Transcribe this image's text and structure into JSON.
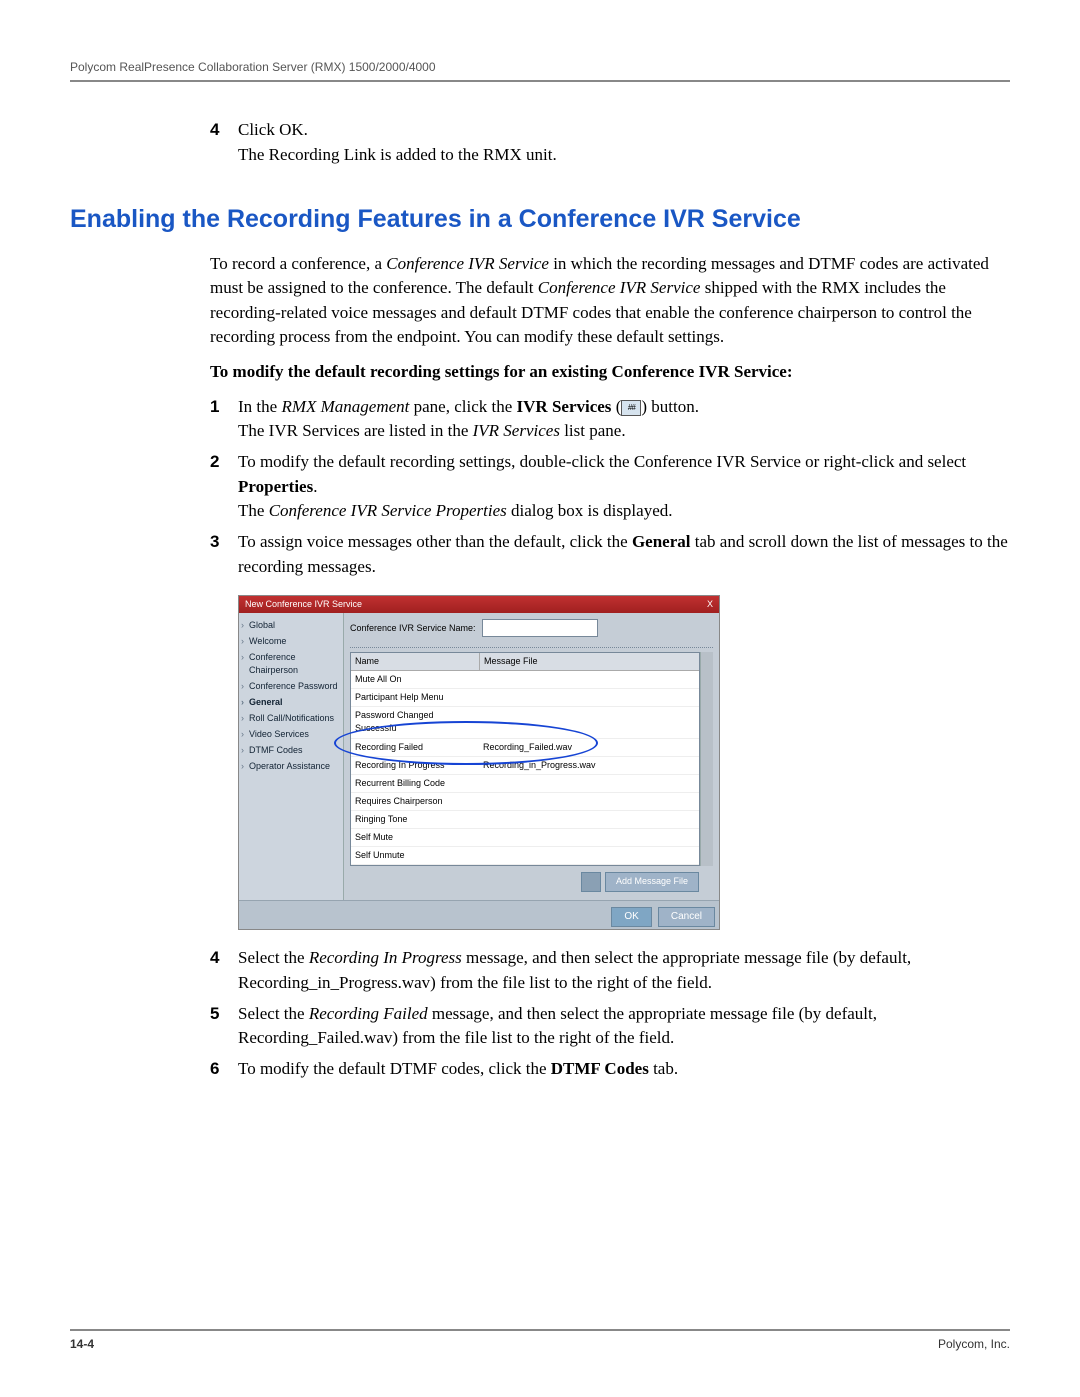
{
  "header": {
    "title": "Polycom RealPresence Collaboration Server (RMX) 1500/2000/4000"
  },
  "pre_steps": {
    "step4_num": "4",
    "step4_a": "Click OK.",
    "step4_b": "The Recording Link is added to the RMX unit."
  },
  "section_heading": "Enabling the Recording Features in a Conference IVR Service",
  "intro": {
    "p1_a": "To record a conference, a ",
    "p1_i1": "Conference IVR Service",
    "p1_b": " in which the recording messages and DTMF codes are activated must be assigned to the conference. The default ",
    "p1_i2": "Conference IVR Service",
    "p1_c": " shipped with the RMX includes the recording-related voice messages and default DTMF codes that enable the conference chairperson to control the recording process from the endpoint. You can modify these default settings."
  },
  "subhead": "To modify the default recording settings for an existing Conference IVR Service:",
  "steps": {
    "s1_num": "1",
    "s1_a": "In the ",
    "s1_i1": "RMX Management",
    "s1_b": " pane, click the ",
    "s1_bold1": "IVR Services",
    "s1_c": " (",
    "s1_d": ") button.",
    "s1_line2a": "The IVR Services are listed in the ",
    "s1_line2i": "IVR Services",
    "s1_line2b": " list pane.",
    "s2_num": "2",
    "s2_a": "To modify the default recording settings, double-click the Conference IVR Service or right-click and select ",
    "s2_bold": "Properties",
    "s2_b": ".",
    "s2_line2a": "The ",
    "s2_line2i": "Conference IVR Service Properties",
    "s2_line2b": " dialog box is displayed.",
    "s3_num": "3",
    "s3_a": "To assign voice messages other than the default, click the ",
    "s3_bold": "General",
    "s3_b": " tab and scroll down the list of messages to the recording messages.",
    "s4_num": "4",
    "s4_a": "Select the ",
    "s4_i": "Recording In Progress",
    "s4_b": " message, and then select the appropriate message file (by default, Recording_in_Progress.wav) from the file list to the right of the field.",
    "s5_num": "5",
    "s5_a": "Select the ",
    "s5_i": "Recording Failed",
    "s5_b": " message, and then select the appropriate message file (by default, Recording_Failed.wav) from the file list to the right of the field.",
    "s6_num": "6",
    "s6_a": "To modify the default DTMF codes, click the ",
    "s6_bold": "DTMF Codes",
    "s6_b": " tab."
  },
  "dialog": {
    "title": "New Conference IVR Service",
    "close": "X",
    "nav": [
      "Global",
      "Welcome",
      "Conference Chairperson",
      "Conference Password",
      "General",
      "Roll Call/Notifications",
      "Video Services",
      "DTMF Codes",
      "Operator Assistance"
    ],
    "field_label": "Conference IVR Service Name:",
    "col_name": "Name",
    "col_file": "Message File",
    "rows": [
      {
        "name": "Mute All On",
        "file": ""
      },
      {
        "name": "Participant Help Menu",
        "file": ""
      },
      {
        "name": "Password Changed Successfu",
        "file": ""
      },
      {
        "name": "Recording Failed",
        "file": "Recording_Failed.wav"
      },
      {
        "name": "Recording In Progress",
        "file": "Recording_in_Progress.wav"
      },
      {
        "name": "Recurrent Billing Code",
        "file": ""
      },
      {
        "name": "Requires Chairperson",
        "file": ""
      },
      {
        "name": "Ringing Tone",
        "file": ""
      },
      {
        "name": "Self Mute",
        "file": ""
      },
      {
        "name": "Self Unmute",
        "file": ""
      }
    ],
    "add_btn": "Add Message File",
    "ok": "OK",
    "cancel": "Cancel"
  },
  "footer": {
    "page": "14-4",
    "company": "Polycom, Inc."
  }
}
